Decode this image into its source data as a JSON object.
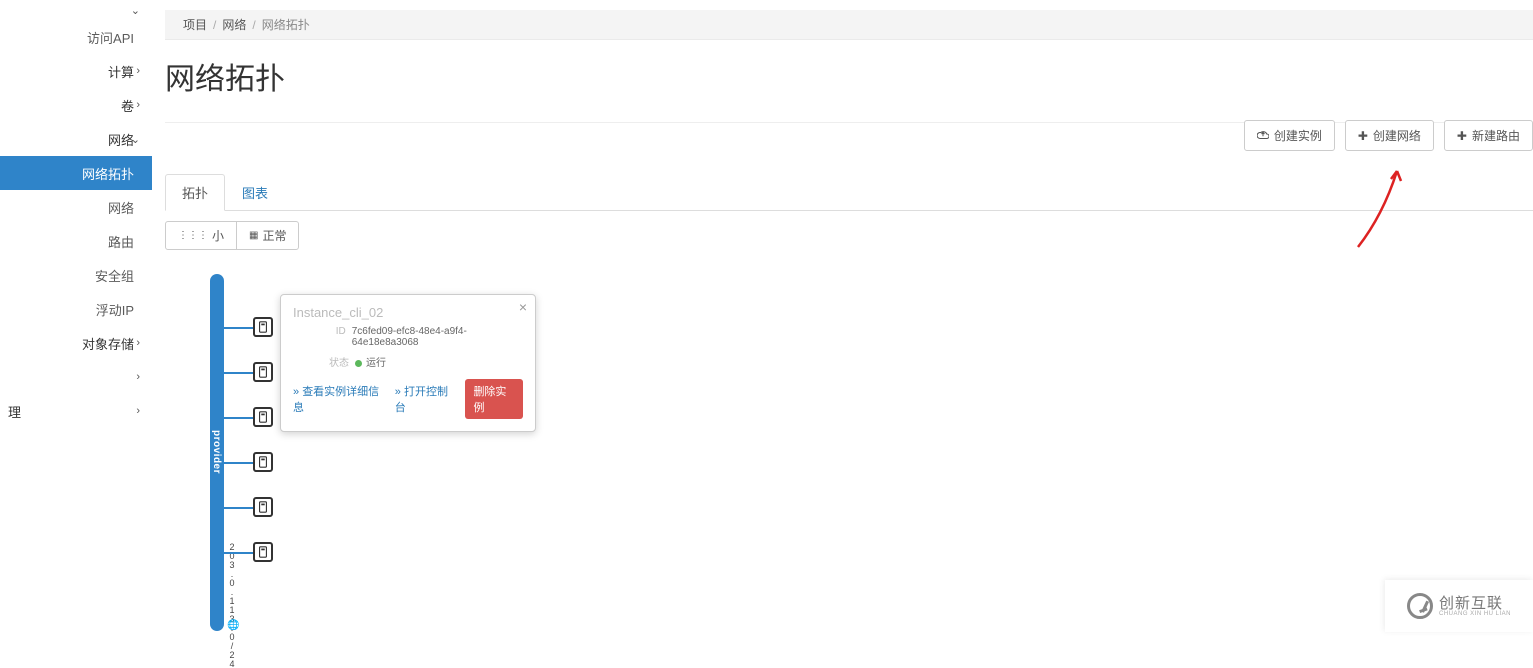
{
  "sidebar": {
    "api": "访问API",
    "compute": "计算",
    "volume": "卷",
    "network": "网络",
    "topology": "网络拓扑",
    "networks": "网络",
    "routers": "路由",
    "secgroups": "安全组",
    "floatip": "浮动IP",
    "objstore": "对象存储",
    "blank1": "",
    "admin": "理"
  },
  "breadcrumb": {
    "item1": "项目",
    "item2": "网络",
    "current": "网络拓扑"
  },
  "page_title": "网络拓扑",
  "toolbar": {
    "create_instance": "创建实例",
    "create_network": "创建网络",
    "create_router": "新建路由"
  },
  "tabs": {
    "topology": "拓扑",
    "graph": "图表"
  },
  "size": {
    "small": "小",
    "normal": "正常"
  },
  "topology": {
    "network_name": "provider",
    "cidr": "203.0.113.0/24",
    "node_count": 6
  },
  "popup": {
    "title": "Instance_cli_02",
    "id_label": "ID",
    "id_value": "7c6fed09-efc8-48e4-a9f4-64e18e8a3068",
    "status_label": "状态",
    "status_value": "运行",
    "view_detail": "查看实例详细信息",
    "open_console": "打开控制台",
    "delete": "删除实例"
  },
  "logo": {
    "name": "创新互联",
    "sub": "CHUANG XIN HU LIAN"
  }
}
